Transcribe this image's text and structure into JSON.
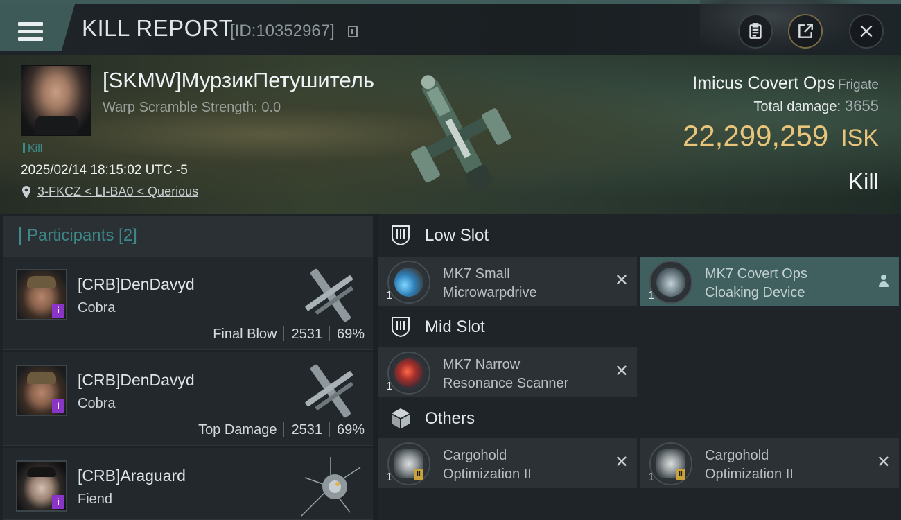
{
  "header": {
    "title": "KILL REPORT",
    "report_id": "[ID:10352967]"
  },
  "victim": {
    "name": "[SKMW]МурзикПетушитель",
    "warp_scramble": "Warp Scramble Strength: 0.0",
    "kill_tag": "Kill",
    "timestamp": "2025/02/14 18:15:02 UTC -5",
    "location": "3-FKCZ < LI-BA0 < Querious",
    "ship_name": "Imicus Covert Ops",
    "ship_class": "Frigate",
    "total_damage_label": "Total damage:",
    "total_damage": "3655",
    "isk_value": "22,299,259",
    "isk_unit": "ISK",
    "result": "Kill"
  },
  "participants": {
    "header": "Participants [2]",
    "rows": [
      {
        "name": "[CRB]DenDavyd",
        "ship": "Cobra",
        "role": "Final Blow",
        "damage": "2531",
        "percent": "69%"
      },
      {
        "name": "[CRB]DenDavyd",
        "ship": "Cobra",
        "role": "Top Damage",
        "damage": "2531",
        "percent": "69%"
      },
      {
        "name": "[CRB]Araguard",
        "ship": "Fiend"
      }
    ],
    "badge": "i"
  },
  "fitting": {
    "low_slot": {
      "label": "Low Slot",
      "modules": [
        {
          "line1": "MK7 Small",
          "line2": "Microwarpdrive",
          "qty": "1"
        },
        {
          "line1": "MK7 Covert Ops",
          "line2": "Cloaking Device",
          "qty": "1"
        }
      ]
    },
    "mid_slot": {
      "label": "Mid Slot",
      "modules": [
        {
          "line1": "MK7 Narrow",
          "line2": "Resonance Scanner",
          "qty": "1"
        }
      ]
    },
    "others": {
      "label": "Others",
      "modules": [
        {
          "line1": "Cargohold",
          "line2": "Optimization II",
          "qty": "1",
          "tier": "II"
        },
        {
          "line1": "Cargohold",
          "line2": "Optimization II",
          "qty": "1",
          "tier": "II"
        }
      ]
    },
    "remove_glyph": "✕"
  },
  "colors": {
    "accent_teal": "#3f8b8c",
    "isk_gold": "#e9c57b",
    "active_module": "#3f605f",
    "badge_purple": "#8b34c8"
  },
  "icons": [
    "menu-icon",
    "copy-icon",
    "clipboard-icon",
    "share-icon",
    "close-icon",
    "location-pin-icon",
    "low-slot-icon",
    "mid-slot-icon",
    "others-cube-icon",
    "remove-icon",
    "person-icon"
  ]
}
